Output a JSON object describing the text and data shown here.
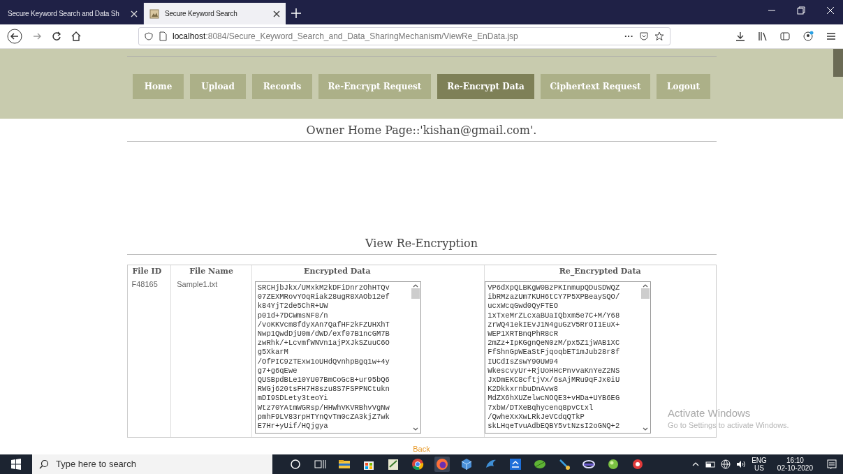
{
  "browser": {
    "tabs": [
      {
        "title": "Secure Keyword Search and Data Sh",
        "selected": false
      },
      {
        "title": "Secure Keyword Search",
        "selected": true
      }
    ],
    "url_host": "localhost",
    "url_rest": ":8084/Secure_Keyword_Search_and_Data_SharingMechanism/ViewRe_EnData.jsp",
    "more": "···"
  },
  "nav": [
    {
      "label": "Home",
      "selected": false
    },
    {
      "label": "Upload",
      "selected": false
    },
    {
      "label": "Records",
      "selected": false
    },
    {
      "label": "Re-Encrypt Request",
      "selected": false
    },
    {
      "label": "Re-Encrypt Data",
      "selected": true
    },
    {
      "label": "Ciphertext Request",
      "selected": false
    },
    {
      "label": "Logout",
      "selected": false
    }
  ],
  "heading": "Owner Home Page::'kishan@gmail.com'.",
  "section_title": "View Re-Encryption",
  "table": {
    "columns": [
      "File ID",
      "File Name",
      "Encrypted Data",
      "Re_Encrypted Data"
    ],
    "rows": [
      {
        "file_id": "F48165",
        "file_name": "Sample1.txt",
        "encrypted": [
          "SRCHjbJkx/UMxkM2kDFiDnrzOhHTQv",
          "07ZEXMRovYOqRiak28ugR8XAOb12ef",
          "k84YjT2de5ChR+UW",
          "p01d+7DCWmsNF8/n",
          "/voKKVcm8fdyXAn7QafHF2kFZUHXhT",
          "Nwp1QwdDjU0m/dWD/exf07B1ncGM7B",
          "zwRhk/+LcvmfWNVn1ajPXJkSZuuC6O",
          "g5XkarM",
          "/OfPIC9zTExw1oUHdQvnhpBgq1w+4y",
          "g7+g6qEwe",
          "QUSBpdBLe10YU07BmCoGcB+ur95bQ6",
          "RWGj620tsFH7H8szu8S7FSPPNCtukn",
          "mDI9SDLety3teoYi",
          "Wtz70YAtmWGRsp/HHWhVKVRBhvVgNw",
          "pmhF9LV83rpHTYnQvTm0cZA3kjZ7wk",
          "E7Hr+yUif/HQjgya"
        ],
        "re_encrypted": [
          "VP6dXpQLBKgW0BzPKInmupQDuSDWQZ",
          "ibRMzazUm7KUH6tCY7P5XPBeaySQO/",
          "ucxWcqGwd0QyFTEO",
          "1xTxeMrZLcxaBUaIQbxm5e7C+M/Y68",
          "zrWQ41ekIEvJ1N4guGzV5RrOI1EuX+",
          "WEP1XRTBnqPhR8cR",
          "2mZz+IpKGgnQeN0zM/px5Z1jWAB1XC",
          "FfShnGpWEaStFjqoqbET1mJub28r8f",
          "IUCdIsZswY90UW94",
          "WkescvyUr+RjUoHHcPnvvaKnYeZ2NS",
          "JxDmEKC8cftjVx/6sAjMRu9qFJx0iU",
          "K2DkkxrnbuDnAvw8",
          "MdZX6hXUZelwcNOQE3+vHDa+UYB6EG",
          "7xbW/DTXeBqhycenq8pvCtxl",
          "/QwheXxXwLRkJeVCdqQTkP",
          "skLHqeTvuAdbEQBY5vtNzsI2oGNQ+2"
        ]
      }
    ]
  },
  "back_link": "Back",
  "activation": {
    "title": "Activate Windows",
    "subtitle": "Go to Settings to activate Windows."
  },
  "taskbar": {
    "search_placeholder": "Type here to search",
    "language": "ENG",
    "region": "US",
    "time": "16:10",
    "date": "02-10-2020"
  }
}
